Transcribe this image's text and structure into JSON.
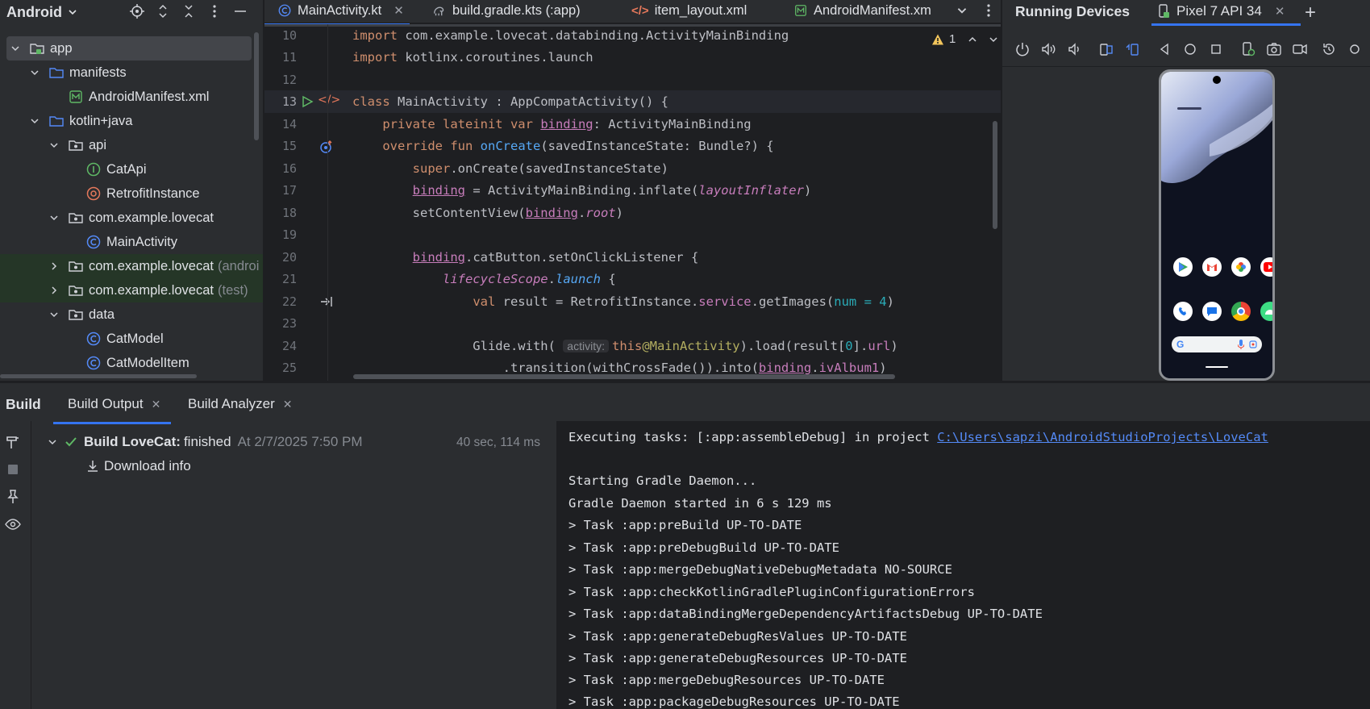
{
  "project": {
    "view": "Android",
    "tree": [
      {
        "label": "app",
        "suffix": ""
      },
      {
        "label": "manifests",
        "suffix": ""
      },
      {
        "label": "AndroidManifest.xml",
        "suffix": ""
      },
      {
        "label": "kotlin+java",
        "suffix": ""
      },
      {
        "label": "api",
        "suffix": ""
      },
      {
        "label": "CatApi",
        "suffix": ""
      },
      {
        "label": "RetrofitInstance",
        "suffix": ""
      },
      {
        "label": "com.example.lovecat",
        "suffix": ""
      },
      {
        "label": "MainActivity",
        "suffix": ""
      },
      {
        "label": "com.example.lovecat",
        "suffix": "(androi"
      },
      {
        "label": "com.example.lovecat",
        "suffix": "(test)"
      },
      {
        "label": "data",
        "suffix": ""
      },
      {
        "label": "CatModel",
        "suffix": ""
      },
      {
        "label": "CatModelItem",
        "suffix": ""
      }
    ]
  },
  "editor": {
    "tabs": [
      {
        "label": "MainActivity.kt",
        "icon": "kotlin-class-icon"
      },
      {
        "label": "build.gradle.kts (:app)",
        "icon": "gradle-icon"
      },
      {
        "label": "item_layout.xml",
        "icon": "xml-icon"
      },
      {
        "label": "AndroidManifest.xm",
        "icon": "manifest-icon"
      }
    ],
    "warning_count": "1",
    "line_numbers": [
      "10",
      "11",
      "12",
      "13",
      "14",
      "15",
      "16",
      "17",
      "18",
      "19",
      "20",
      "21",
      "22",
      "23",
      "24",
      "25"
    ],
    "inlay_hint": "activity:"
  },
  "devices": {
    "title": "Running Devices",
    "device_tab": "Pixel 7 API 34"
  },
  "build": {
    "title": "Build",
    "tabs": [
      "Build Output",
      "Build Analyzer"
    ],
    "result_prefix": "Build LoveCat:",
    "result_status": "finished",
    "result_time": "At 2/7/2025 7:50 PM",
    "duration": "40 sec, 114 ms",
    "download_info": "Download info",
    "console": {
      "exec_prefix": "Executing tasks: [:app:assembleDebug] in project ",
      "exec_path": "C:\\Users\\sapzi\\AndroidStudioProjects\\LoveCat",
      "lines": [
        "",
        "Starting Gradle Daemon...",
        "Gradle Daemon started in 6 s 129 ms",
        "> Task :app:preBuild UP-TO-DATE",
        "> Task :app:preDebugBuild UP-TO-DATE",
        "> Task :app:mergeDebugNativeDebugMetadata NO-SOURCE",
        "> Task :app:checkKotlinGradlePluginConfigurationErrors",
        "> Task :app:dataBindingMergeDependencyArtifactsDebug UP-TO-DATE",
        "> Task :app:generateDebugResValues UP-TO-DATE",
        "> Task :app:generateDebugResources UP-TO-DATE",
        "> Task :app:mergeDebugResources UP-TO-DATE",
        "> Task :app:packageDebugResources UP-TO-DATE"
      ]
    }
  },
  "colors": {
    "accent": "#3574f0",
    "success": "#5fb865",
    "warning": "#f2c55c",
    "link": "#548af7"
  }
}
